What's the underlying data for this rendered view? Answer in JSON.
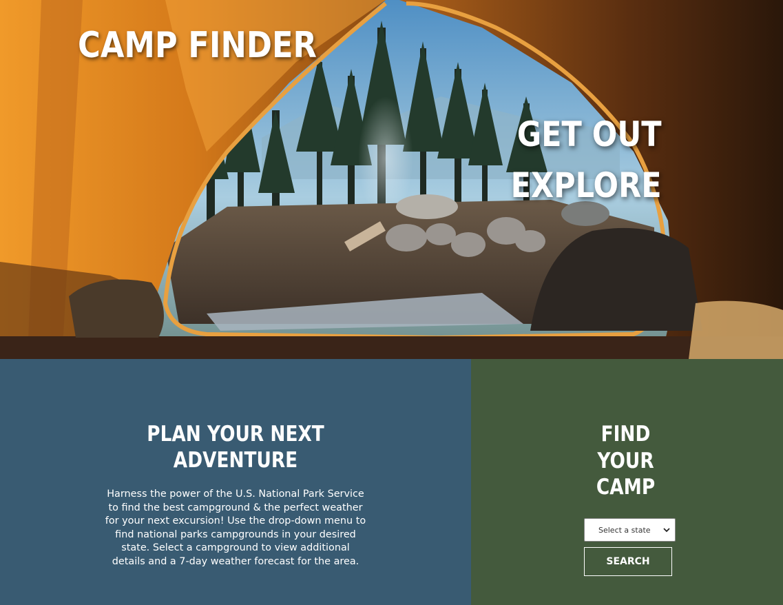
{
  "hero": {
    "brand": "CAMP FINDER",
    "tagline_line1": "GET OUT",
    "tagline_line2": "EXPLORE",
    "image": "photo-inside-tent-looking-out-at-forest-campsite"
  },
  "plan": {
    "title_line1": "PLAN YOUR NEXT",
    "title_line2": "ADVENTURE",
    "description": "Harness the power of the U.S. National Park Service to find the best campground & the perfect weather for your next excursion! Use the drop-down menu to find national parks campgrounds in your desired state. Select a campground to view additional details and a 7-day weather forecast for the area."
  },
  "find": {
    "title_line1": "FIND",
    "title_line2": "YOUR",
    "title_line3": "CAMP",
    "state_select_value": "Select a state",
    "search_label": "SEARCH"
  },
  "colors": {
    "plan_bg": "#395b72",
    "find_bg": "#445a3d",
    "tent_orange": "#e08a1e",
    "text": "#ffffff"
  },
  "icons": {
    "select_chevron": "chevron-down-icon"
  }
}
